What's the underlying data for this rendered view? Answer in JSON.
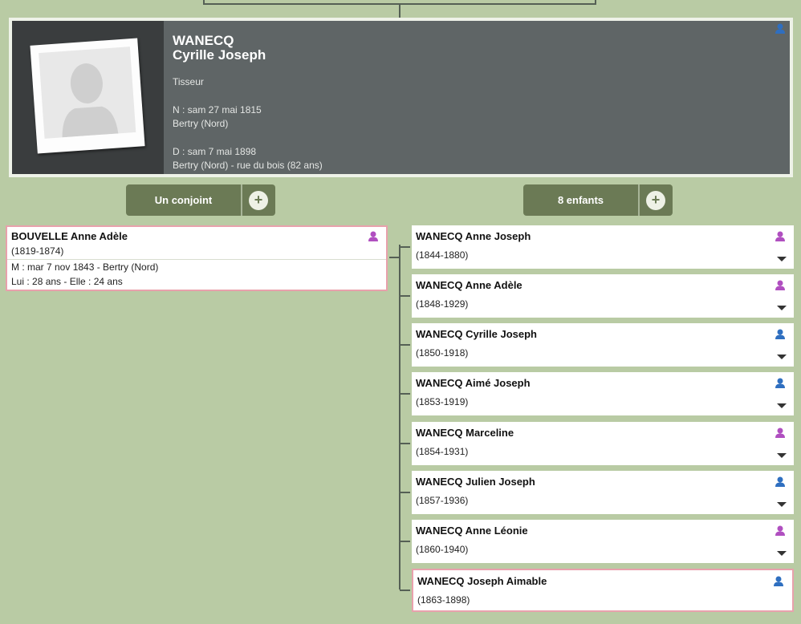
{
  "person": {
    "surname": "WANECQ",
    "firstname": "Cyrille Joseph",
    "occupation": "Tisseur",
    "birth": "N : sam 27 mai 1815",
    "birth_place": "Bertry (Nord)",
    "death": "D : sam 7 mai 1898",
    "death_place": "Bertry (Nord) - rue du bois (82 ans)",
    "sex_icon": "male-person-icon"
  },
  "spouse_section": {
    "label": "Un conjoint",
    "add": "+"
  },
  "children_section": {
    "label": "8 enfants",
    "add": "+"
  },
  "spouse": {
    "name": "BOUVELLE Anne Adèle",
    "dates": "(1819-1874)",
    "marriage": "M : mar 7 nov 1843 - Bertry (Nord)",
    "ages": "Lui : 28 ans - Elle : 24 ans",
    "sex_icon": "female-person-icon"
  },
  "children": [
    {
      "name": "WANECQ Anne Joseph",
      "dates": "(1844-1880)",
      "sex": "female"
    },
    {
      "name": "WANECQ Anne Adèle",
      "dates": "(1848-1929)",
      "sex": "female"
    },
    {
      "name": "WANECQ Cyrille Joseph",
      "dates": "(1850-1918)",
      "sex": "male"
    },
    {
      "name": "WANECQ Aimé Joseph",
      "dates": "(1853-1919)",
      "sex": "male"
    },
    {
      "name": "WANECQ Marceline",
      "dates": "(1854-1931)",
      "sex": "female"
    },
    {
      "name": "WANECQ Julien Joseph",
      "dates": "(1857-1936)",
      "sex": "male"
    },
    {
      "name": "WANECQ Anne Léonie",
      "dates": "(1860-1940)",
      "sex": "female"
    },
    {
      "name": "WANECQ Joseph Aimable",
      "dates": "(1863-1898)",
      "sex": "male"
    }
  ],
  "colors": {
    "background": "#b9cba4",
    "male": "#2f6fc0",
    "female": "#b04fc0",
    "highlight_border": "#e8a1ac",
    "button": "#6b7a55"
  }
}
